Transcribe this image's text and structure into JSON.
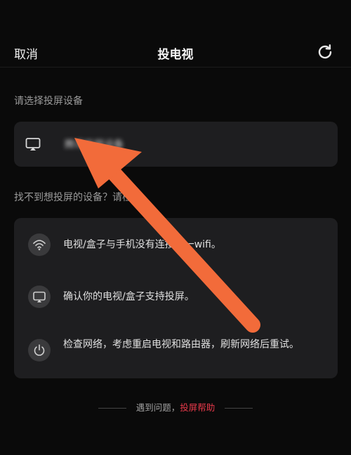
{
  "header": {
    "cancel_label": "取消",
    "title": "投电视",
    "refresh_icon": "refresh-icon"
  },
  "device_section": {
    "label": "请选择投屏设备",
    "device": {
      "icon": "screen-cast-icon",
      "name": "腾讯投屏设备"
    }
  },
  "help_section": {
    "label": "找不到想投屏的设备？请检查",
    "tips": [
      {
        "icon": "wifi-icon",
        "text": "电视/盒子与手机没有连接同一wifi。"
      },
      {
        "icon": "screen-cast-icon",
        "text": "确认你的电视/盒子支持投屏。"
      },
      {
        "icon": "power-icon",
        "text": "检查网络，考虑重启电视和路由器，刷新网络后重试。"
      }
    ]
  },
  "footer": {
    "prefix": "遇到问题，",
    "link": "投屏帮助"
  },
  "colors": {
    "background": "#0a0a0a",
    "card": "#1e1e20",
    "accent_link": "#e8394a",
    "annotation_arrow": "#f26b3a"
  }
}
